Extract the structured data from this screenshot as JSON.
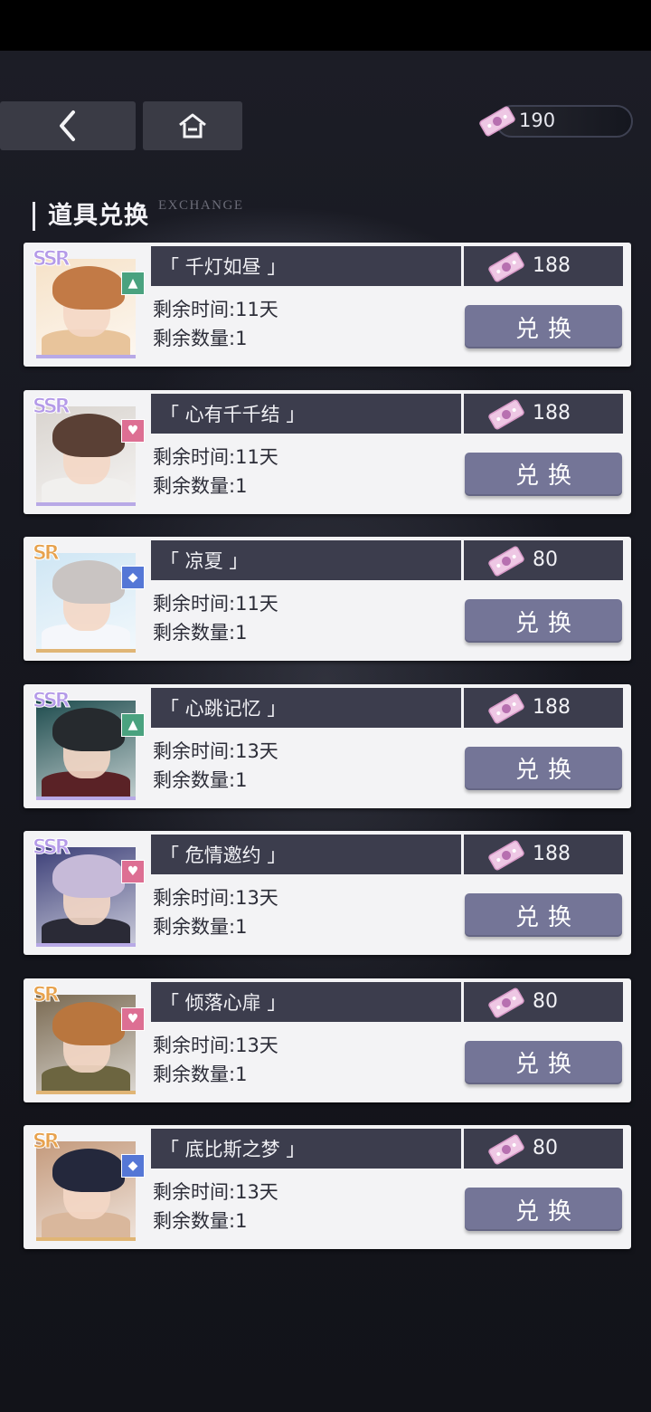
{
  "header": {
    "back_icon": "chevron-left-icon",
    "home_icon": "home-icon",
    "currency": {
      "icon": "pink-ticket-icon",
      "value": "190"
    }
  },
  "section": {
    "title": "道具兑换",
    "subtitle": "EXCHANGE"
  },
  "items": [
    {
      "rarity": "SSR",
      "attribute": "green-triangle-icon",
      "name": "「 千灯如昼 」",
      "price": "188",
      "time_label": "剩余时间:",
      "time_value": "11天",
      "qty_label": "剩余数量:",
      "qty_value": "1",
      "button": "兑换"
    },
    {
      "rarity": "SSR",
      "attribute": "pink-heart-icon",
      "name": "「 心有千千结 」",
      "price": "188",
      "time_label": "剩余时间:",
      "time_value": "11天",
      "qty_label": "剩余数量:",
      "qty_value": "1",
      "button": "兑换"
    },
    {
      "rarity": "SR",
      "attribute": "blue-diamond-icon",
      "name": "「 凉夏 」",
      "price": "80",
      "time_label": "剩余时间:",
      "time_value": "11天",
      "qty_label": "剩余数量:",
      "qty_value": "1",
      "button": "兑换"
    },
    {
      "rarity": "SSR",
      "attribute": "green-triangle-icon",
      "name": "「 心跳记忆 」",
      "price": "188",
      "time_label": "剩余时间:",
      "time_value": "13天",
      "qty_label": "剩余数量:",
      "qty_value": "1",
      "button": "兑换"
    },
    {
      "rarity": "SSR",
      "attribute": "pink-heart-icon",
      "name": "「 危情邀约 」",
      "price": "188",
      "time_label": "剩余时间:",
      "time_value": "13天",
      "qty_label": "剩余数量:",
      "qty_value": "1",
      "button": "兑换"
    },
    {
      "rarity": "SR",
      "attribute": "pink-heart-icon",
      "name": "「 倾落心扉 」",
      "price": "80",
      "time_label": "剩余时间:",
      "time_value": "13天",
      "qty_label": "剩余数量:",
      "qty_value": "1",
      "button": "兑换"
    },
    {
      "rarity": "SR",
      "attribute": "blue-diamond-icon",
      "name": "「 底比斯之梦 」",
      "price": "80",
      "time_label": "剩余时间:",
      "time_value": "13天",
      "qty_label": "剩余数量:",
      "qty_value": "1",
      "button": "兑换"
    }
  ]
}
